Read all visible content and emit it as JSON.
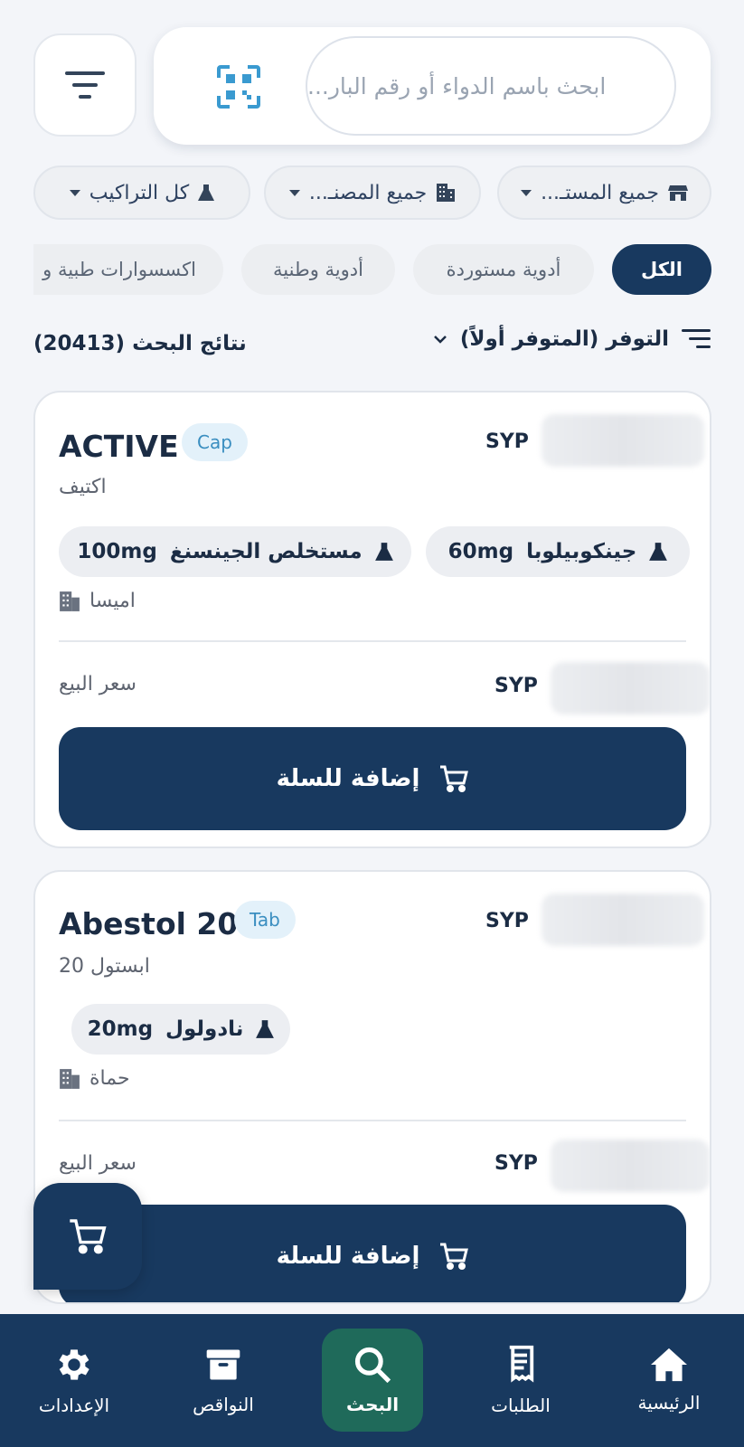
{
  "search": {
    "placeholder": "ابحث باسم الدواء أو رقم البار...",
    "filter_icon": "filter-lines-icon",
    "scan_icon": "qr-scan-icon"
  },
  "filters": {
    "warehouses": "جميع المستـ...",
    "manufacturers": "جميع المصنـ...",
    "compositions": "كل التراكيب"
  },
  "categories": [
    {
      "label": "الكل",
      "active": true
    },
    {
      "label": "أدوية مستوردة",
      "active": false
    },
    {
      "label": "أدوية وطنية",
      "active": false
    },
    {
      "label": "اكسسوارات طبية و",
      "active": false
    }
  ],
  "results": {
    "title": "نتائج البحث (20413)",
    "sort_label": "التوفر (المتوفر أولاً)"
  },
  "products": [
    {
      "name": "ACTIVE",
      "form": "Cap",
      "name_ar": "اكتيف",
      "currency": "SYP",
      "ingredients": [
        {
          "name": "جينكوبيلوبا",
          "dose": "60mg"
        },
        {
          "name": "مستخلص الجينسنغ",
          "dose": "100mg"
        }
      ],
      "manufacturer": "اميسا",
      "sale_label": "سعر البيع",
      "sale_currency": "SYP",
      "add_label": "إضافة للسلة"
    },
    {
      "name": "Abestol 20",
      "form": "Tab",
      "name_ar": "ابستول 20",
      "currency": "SYP",
      "ingredients": [
        {
          "name": "نادولول",
          "dose": "20mg"
        }
      ],
      "manufacturer": "حماة",
      "sale_label": "سعر البيع",
      "sale_currency": "SYP",
      "add_label": "إضافة للسلة"
    }
  ],
  "nav": [
    {
      "label": "الإعدادات",
      "icon": "gear-icon",
      "active": false
    },
    {
      "label": "النواقص",
      "icon": "archive-box-icon",
      "active": false
    },
    {
      "label": "البحث",
      "icon": "search-icon",
      "active": true
    },
    {
      "label": "الطلبات",
      "icon": "receipt-icon",
      "active": false
    },
    {
      "label": "الرئيسية",
      "icon": "home-icon",
      "active": false
    }
  ],
  "colors": {
    "primary": "#18395f",
    "active_nav": "#1f6a5a",
    "badge_bg": "#e3f1fa",
    "badge_text": "#3a8ec0"
  }
}
